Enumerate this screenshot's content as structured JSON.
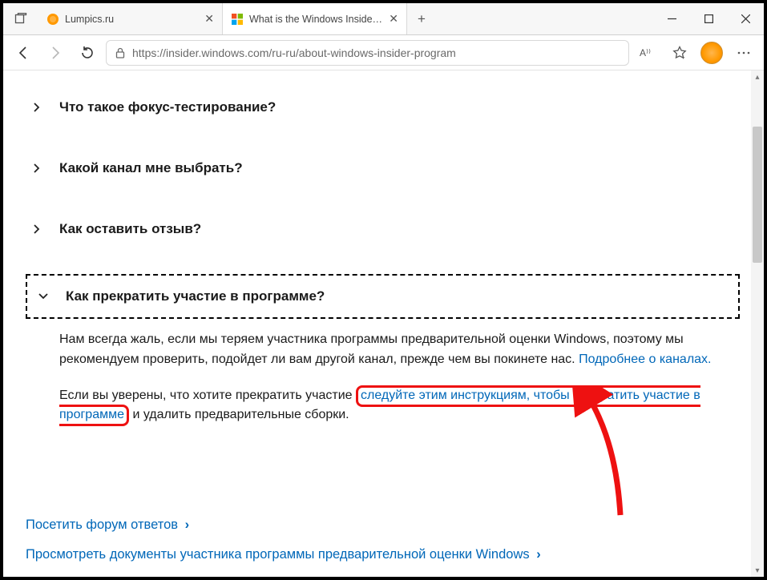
{
  "tabs": [
    {
      "title": "Lumpics.ru"
    },
    {
      "title": "What is the Windows Insider Prog"
    }
  ],
  "url": "https://insider.windows.com/ru-ru/about-windows-insider-program",
  "faq": [
    {
      "q": "Что такое фокус-тестирование?"
    },
    {
      "q": "Какой канал мне выбрать?"
    },
    {
      "q": "Как оставить отзыв?"
    },
    {
      "q": "Как прекратить участие в программе?"
    }
  ],
  "answer": {
    "p1a": "Нам всегда жаль, если мы теряем участника программы предварительной оценки Windows, поэтому мы рекомендуем проверить, подойдет ли вам другой канал, прежде чем вы покинете нас. ",
    "link1": "Подробнее о каналах.",
    "p2a": "Если вы уверены, что хотите прекратить участие ",
    "link2": "следуйте этим инструкциям, чтобы прекратить участие в программе",
    "p2b": " и удалить предварительные сборки."
  },
  "bottomLinks": [
    "Посетить форум ответов",
    "Просмотреть документы участника программы предварительной оценки Windows"
  ]
}
